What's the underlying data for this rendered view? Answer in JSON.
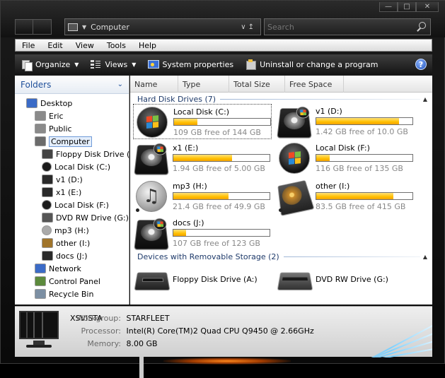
{
  "address": {
    "path": "Computer"
  },
  "search": {
    "placeholder": "Search"
  },
  "menu": [
    "File",
    "Edit",
    "View",
    "Tools",
    "Help"
  ],
  "toolbar": {
    "organize": "Organize",
    "views": "Views",
    "system_properties": "System properties",
    "uninstall": "Uninstall or change a program",
    "help": "?"
  },
  "folders": {
    "title": "Folders",
    "items": [
      {
        "label": "Desktop",
        "icon": "desktop-icon",
        "level": 0
      },
      {
        "label": "Eric",
        "icon": "user-icon",
        "level": 1
      },
      {
        "label": "Public",
        "icon": "user-icon",
        "level": 1
      },
      {
        "label": "Computer",
        "icon": "computer-icon",
        "level": 1,
        "selected": true
      },
      {
        "label": "Floppy Disk Drive (A:)",
        "icon": "floppy-icon",
        "level": 2
      },
      {
        "label": "Local Disk (C:)",
        "icon": "windows-disk-icon",
        "level": 2
      },
      {
        "label": "v1 (D:)",
        "icon": "hard-disk-icon",
        "level": 2
      },
      {
        "label": "x1 (E:)",
        "icon": "hard-disk-icon",
        "level": 2
      },
      {
        "label": "Local Disk (F:)",
        "icon": "windows-disk-icon",
        "level": 2
      },
      {
        "label": "DVD RW Drive (G:)",
        "icon": "dvd-icon",
        "level": 2
      },
      {
        "label": "mp3 (H:)",
        "icon": "music-disk-icon",
        "level": 2
      },
      {
        "label": "other (I:)",
        "icon": "other-disk-icon",
        "level": 2
      },
      {
        "label": "docs (J:)",
        "icon": "hard-disk-icon",
        "level": 2
      },
      {
        "label": "Network",
        "icon": "network-icon",
        "level": 1
      },
      {
        "label": "Control Panel",
        "icon": "control-panel-icon",
        "level": 1
      },
      {
        "label": "Recycle Bin",
        "icon": "recycle-bin-icon",
        "level": 1
      }
    ]
  },
  "columns": [
    "Name",
    "Type",
    "Total Size",
    "Free Space"
  ],
  "groups": {
    "hdd": "Hard Disk Drives (7)",
    "removable": "Devices with Removable Storage (2)"
  },
  "drives": [
    {
      "name": "Local Disk (C:)",
      "free": "109 GB free of 144 GB",
      "used_fraction": 0.24,
      "icon": "windows-disk-icon"
    },
    {
      "name": "v1 (D:)",
      "free": "1.42 GB free of 10.0 GB",
      "used_fraction": 0.86,
      "icon": "hard-disk-icon"
    },
    {
      "name": "x1 (E:)",
      "free": "1.94 GB free of 5.00 GB",
      "used_fraction": 0.61,
      "icon": "hard-disk-icon"
    },
    {
      "name": "Local Disk (F:)",
      "free": "116 GB free of 135 GB",
      "used_fraction": 0.14,
      "icon": "windows-disk-icon"
    },
    {
      "name": "mp3 (H:)",
      "free": "21.4 GB free of 49.9 GB",
      "used_fraction": 0.57,
      "icon": "music-disk-icon"
    },
    {
      "name": "other (I:)",
      "free": "83.5 GB free of 415 GB",
      "used_fraction": 0.8,
      "icon": "other-disk-icon"
    },
    {
      "name": "docs (J:)",
      "free": "107 GB free of 123 GB",
      "used_fraction": 0.13,
      "icon": "hard-disk-icon"
    }
  ],
  "devices": [
    {
      "name": "Floppy Disk Drive (A:)",
      "icon": "floppy-icon"
    },
    {
      "name": "DVD RW Drive (G:)",
      "icon": "dvd-icon"
    }
  ],
  "details": {
    "computer_name": "XSVISTA",
    "workgroup_label": "Workgroup:",
    "workgroup": "STARFLEET",
    "processor_label": "Processor:",
    "processor": "Intel(R) Core(TM)2 Quad  CPU   Q9450  @ 2.66GHz",
    "memory_label": "Memory:",
    "memory": "8.00 GB"
  },
  "colors": {
    "accent": "#1e4f9a",
    "bar_fill": "#ffbf00"
  }
}
